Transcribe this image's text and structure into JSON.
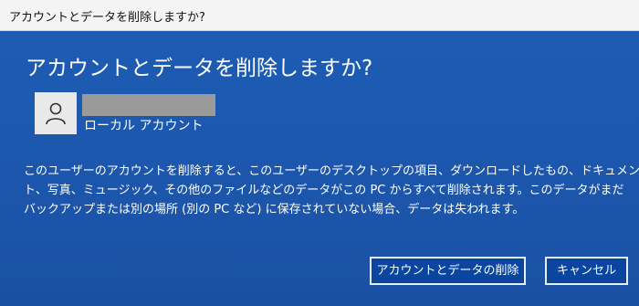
{
  "window": {
    "title": "アカウントとデータを削除しますか?"
  },
  "dialog": {
    "heading": "アカウントとデータを削除しますか?",
    "account": {
      "name_redacted": true,
      "type": "ローカル アカウント",
      "avatar_icon": "user-icon"
    },
    "description_lines": [
      "このユーザーのアカウントを削除すると、このユーザーのデスクトップの項目、ダウンロードしたもの、ドキュメン",
      "ト、写真、ミュージック、その他のファイルなどのデータがこの PC からすべて削除されます。このデータがまだ",
      "バックアップまたは別の場所 (別の PC など) に保存されていない場合、データは失われます。"
    ],
    "buttons": {
      "delete_label": "アカウントとデータの削除",
      "cancel_label": "キャンセル"
    }
  },
  "colors": {
    "background": "#1e5db5",
    "titlebar": "#f4f4f4",
    "button": "#0a46a0",
    "text": "#ffffff"
  }
}
